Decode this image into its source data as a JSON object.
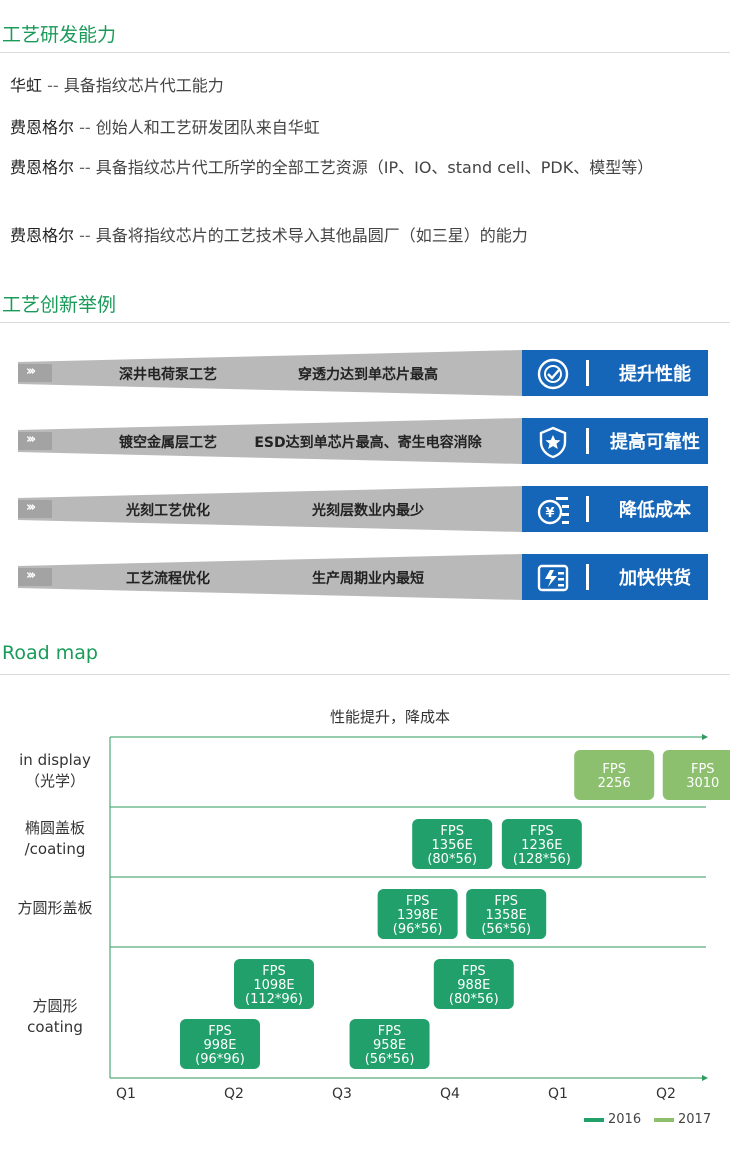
{
  "sections": {
    "capability_title": "工艺研发能力",
    "innovation_title": "工艺创新举例",
    "roadmap_title": "Road map"
  },
  "capabilities": [
    {
      "who": "华虹",
      "sep": " -- ",
      "text": "具备指纹芯片代工能力"
    },
    {
      "who": "费恩格尔",
      "sep": " -- ",
      "text": "创始人和工艺研发团队来自华虹"
    },
    {
      "who": "费恩格尔",
      "sep": " -- ",
      "text": "具备指纹芯片代工所学的全部工艺资源（IP、IO、stand cell、PDK、模型等）"
    },
    {
      "who": "费恩格尔",
      "sep": " -- ",
      "text": "具备将指纹芯片的工艺技术导入其他晶圆厂（如三星）的能力"
    }
  ],
  "innovations": [
    {
      "tech": "深井电荷泵工艺",
      "effect": "穿透力达到单芯片最高",
      "benefit": "提升性能",
      "icon": "speedometer-icon"
    },
    {
      "tech": "镀空金属层工艺",
      "effect": "ESD达到单芯片最高、寄生电容消除",
      "benefit": "提高可靠性",
      "icon": "shield-star-icon"
    },
    {
      "tech": "光刻工艺优化",
      "effect": "光刻层数业内最少",
      "benefit": "降低成本",
      "icon": "yen-coin-icon"
    },
    {
      "tech": "工艺流程优化",
      "effect": "生产周期业内最短",
      "benefit": "加快供货",
      "icon": "fast-delivery-icon"
    }
  ],
  "colors": {
    "accent_green": "#1a9b5a",
    "banner_blue": "#1565b8",
    "banner_gray": "#b9b9b9",
    "bar_2016": "#22a06b",
    "bar_2017": "#8cc06e",
    "axis_green": "#2e9a5e"
  },
  "chart_data": {
    "type": "table",
    "title": "性能提升，降成本",
    "x_ticks": [
      "Q1",
      "Q2",
      "Q3",
      "Q4",
      "Q1",
      "Q2"
    ],
    "rows": [
      {
        "label": "in display\n（光学）"
      },
      {
        "label": "椭圆盖板\n/coating"
      },
      {
        "label": "方圆形盖板"
      },
      {
        "label": "方圆形\ncoating"
      }
    ],
    "items": [
      {
        "row": 0,
        "quarter": 4.15,
        "lane": 0,
        "series": "2017",
        "lines": [
          "FPS",
          "2256"
        ]
      },
      {
        "row": 0,
        "quarter": 4.97,
        "lane": 0,
        "series": "2017",
        "lines": [
          "FPS",
          "3010"
        ]
      },
      {
        "row": 1,
        "quarter": 2.65,
        "lane": 0,
        "series": "2016",
        "lines": [
          "FPS",
          "1356E",
          "(80*56)"
        ]
      },
      {
        "row": 1,
        "quarter": 3.48,
        "lane": 0,
        "series": "2016",
        "lines": [
          "FPS",
          "1236E",
          "(128*56)"
        ]
      },
      {
        "row": 2,
        "quarter": 2.33,
        "lane": 0,
        "series": "2016",
        "lines": [
          "FPS",
          "1398E",
          "(96*56)"
        ]
      },
      {
        "row": 2,
        "quarter": 3.15,
        "lane": 0,
        "series": "2016",
        "lines": [
          "FPS",
          "1358E",
          "(56*56)"
        ]
      },
      {
        "row": 3,
        "quarter": 1.0,
        "lane": 0,
        "series": "2016",
        "lines": [
          "FPS",
          "1098E",
          "(112*96)"
        ]
      },
      {
        "row": 3,
        "quarter": 2.85,
        "lane": 0,
        "series": "2016",
        "lines": [
          "FPS",
          "988E",
          "(80*56)"
        ]
      },
      {
        "row": 3,
        "quarter": 0.5,
        "lane": 1,
        "series": "2016",
        "lines": [
          "FPS",
          "998E",
          "(96*96)"
        ]
      },
      {
        "row": 3,
        "quarter": 2.07,
        "lane": 1,
        "series": "2016",
        "lines": [
          "FPS",
          "958E",
          "(56*56)"
        ]
      }
    ],
    "legend": [
      {
        "name": "2016",
        "color": "#22a06b"
      },
      {
        "name": "2017",
        "color": "#8cc06e"
      }
    ]
  }
}
